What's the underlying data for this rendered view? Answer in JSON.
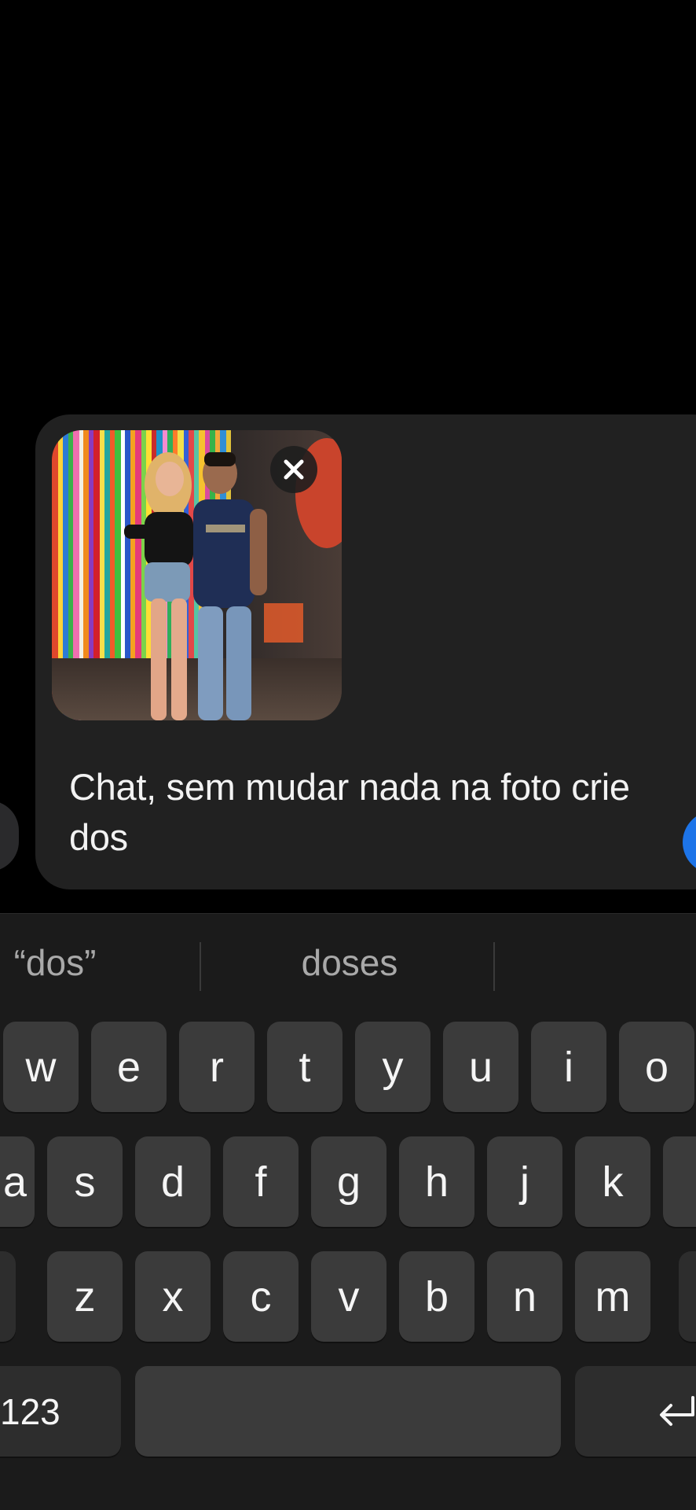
{
  "composer": {
    "message_text": "Chat, sem mudar nada na foto crie dos",
    "image_alt": "",
    "accent_color": "#1d74e8"
  },
  "keyboard": {
    "suggestions": [
      "“dos”",
      "doses"
    ],
    "row1": [
      "w",
      "e",
      "r",
      "t",
      "y",
      "u",
      "i",
      "o"
    ],
    "row2": [
      "a",
      "s",
      "d",
      "f",
      "g",
      "h",
      "j",
      "k"
    ],
    "row3": [
      "z",
      "x",
      "c",
      "v",
      "b",
      "n",
      "m"
    ],
    "numbers_key": "123",
    "return_icon": "return-icon"
  }
}
